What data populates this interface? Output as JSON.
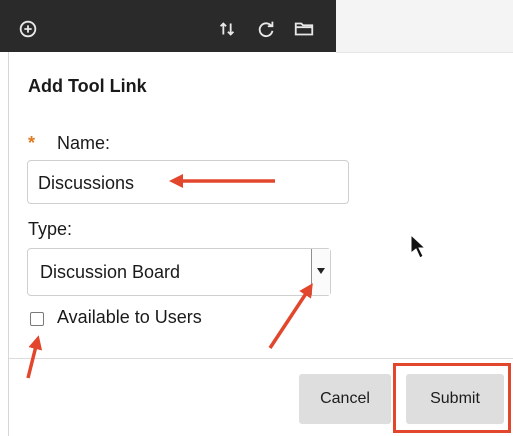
{
  "form": {
    "title": "Add Tool Link",
    "name_label": "Name:",
    "required_marker": "*",
    "name_value": "Discussions",
    "type_label": "Type:",
    "type_selected": "Discussion Board",
    "available_label": "Available to Users",
    "available_checked": false
  },
  "buttons": {
    "cancel": "Cancel",
    "submit": "Submit"
  },
  "toolbar": {
    "icons": [
      "plus-circle-icon",
      "sort-icon",
      "refresh-icon",
      "folder-icon"
    ]
  },
  "colors": {
    "toolbar": "#2a2a2a",
    "required": "#e07a1f",
    "annotation": "#e2462c"
  }
}
